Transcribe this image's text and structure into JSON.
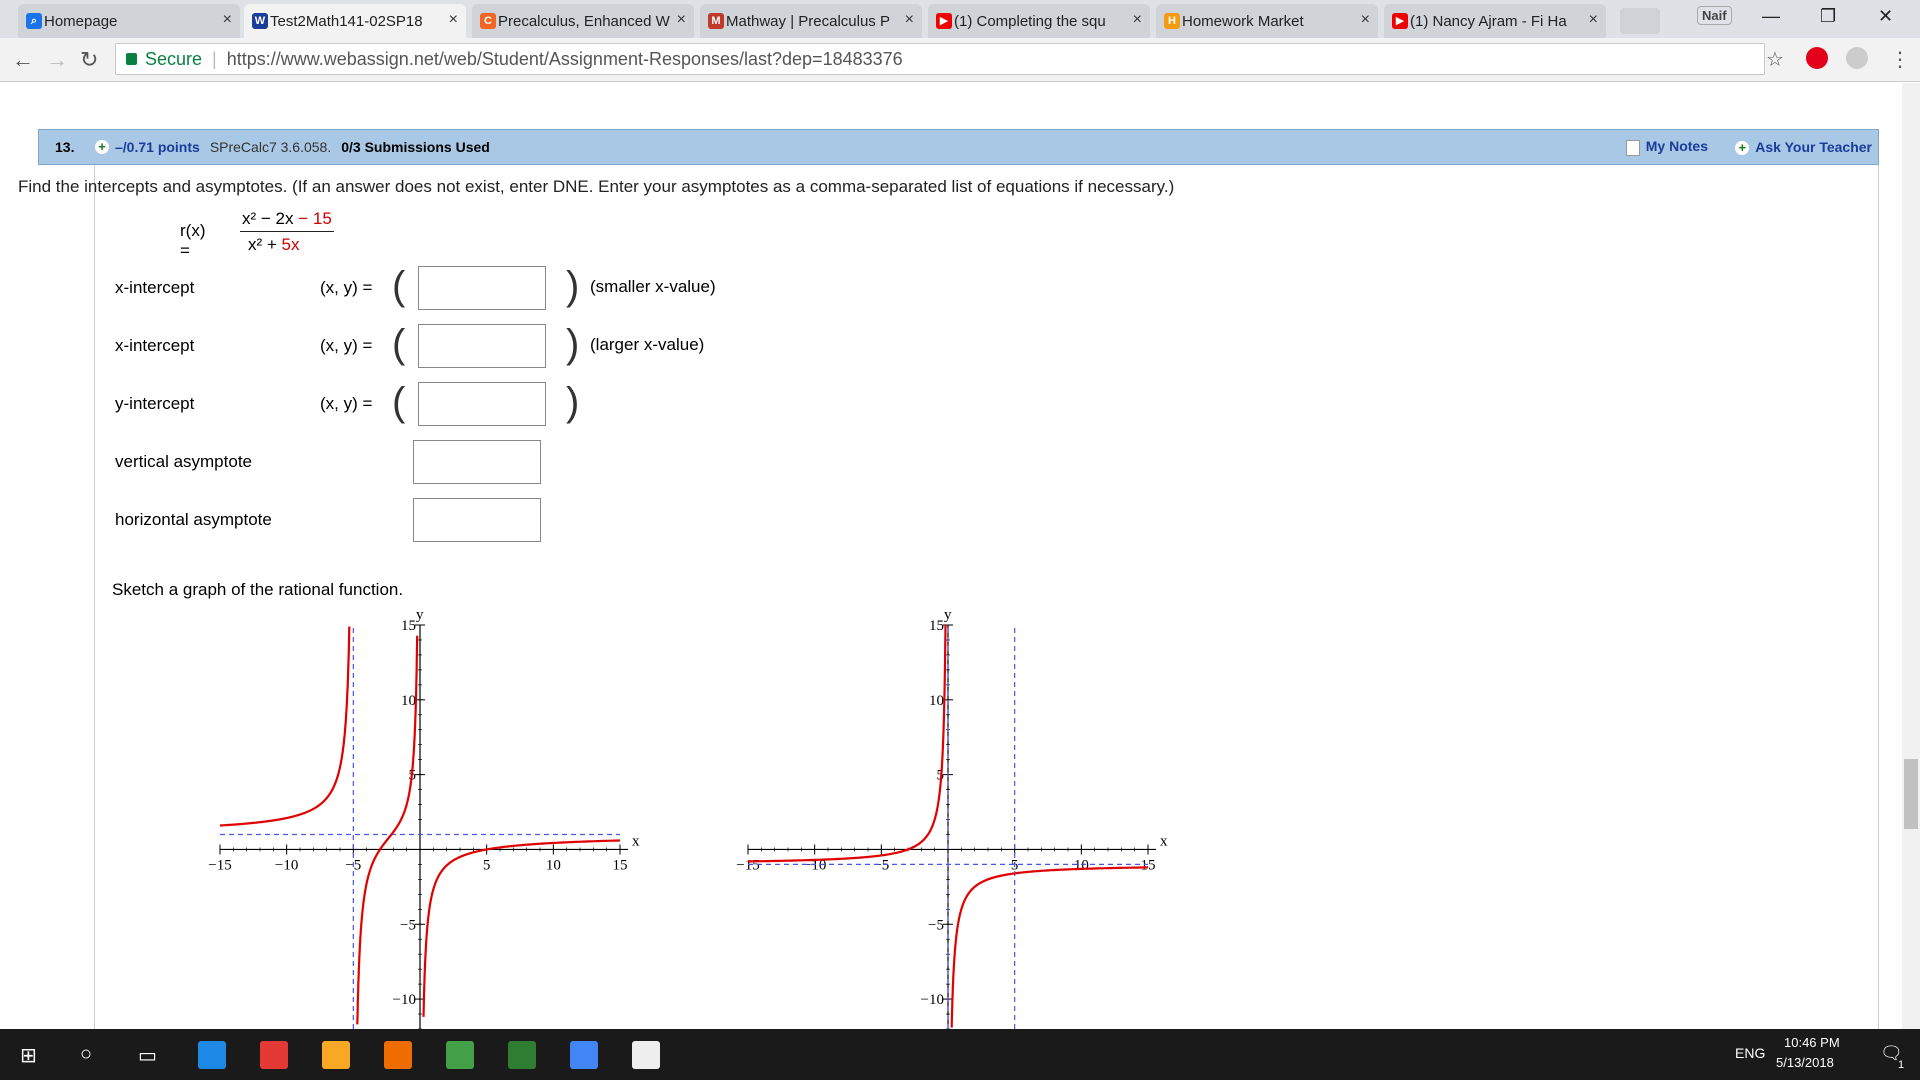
{
  "browser": {
    "tabs": [
      {
        "label": "Homepage",
        "icon": "search-icon",
        "color": "#1a73e8"
      },
      {
        "label": "Test2Math141-02SP18",
        "icon": "webassign-icon",
        "color": "#1a3d99"
      },
      {
        "label": "Precalculus, Enhanced W",
        "icon": "cengage-icon",
        "color": "#f26522"
      },
      {
        "label": "Mathway | Precalculus P",
        "icon": "mathway-icon",
        "color": "#c0392b"
      },
      {
        "label": "(1) Completing the squ",
        "icon": "youtube-icon",
        "color": "#e00"
      },
      {
        "label": "Homework Market",
        "icon": "homework-market-icon",
        "color": "#f39c12"
      },
      {
        "label": "(1) Nancy Ajram - Fi Ha",
        "icon": "youtube-icon",
        "color": "#e00"
      }
    ],
    "user_badge": "Naif",
    "address": {
      "secure_label": "Secure",
      "url": "https://www.webassign.net/web/Student/Assignment-Responses/last?dep=18483376"
    }
  },
  "question": {
    "number": "13.",
    "points": "–/0.71 points",
    "code": "SPreCalc7 3.6.058.",
    "submissions": "0/3 Submissions Used",
    "my_notes": "My Notes",
    "ask_teacher": "Ask Your Teacher",
    "instructions": "Find the intercepts and asymptotes. (If an answer does not exist, enter DNE. Enter your asymptotes as a comma-separated list of equations if necessary.)",
    "function": {
      "name": "r(x) =",
      "num_black": "x² − 2x",
      "num_red": "− 15",
      "den_black": "x² +",
      "den_red": "5x"
    },
    "rows": [
      {
        "label": "x-intercept",
        "xy": "(x, y) =",
        "note": "(smaller x-value)",
        "value": ""
      },
      {
        "label": "x-intercept",
        "xy": "(x, y) =",
        "note": "(larger x-value)",
        "value": ""
      },
      {
        "label": "y-intercept",
        "xy": "(x, y) =",
        "note": "",
        "value": ""
      },
      {
        "label": "vertical asymptote",
        "xy": "",
        "note": "",
        "value": ""
      },
      {
        "label": "horizontal asymptote",
        "xy": "",
        "note": "",
        "value": ""
      }
    ],
    "sketch_prompt": "Sketch a graph of the rational function."
  },
  "chart_data": [
    {
      "type": "line",
      "xlabel": "x",
      "ylabel": "y",
      "xlim": [
        -15,
        15
      ],
      "ylim": [
        -12,
        15
      ],
      "xticks": [
        -15,
        -10,
        -5,
        5,
        10,
        15
      ],
      "yticks": [
        -10,
        -5,
        5,
        10,
        15
      ],
      "asymptotes": {
        "vertical": [
          -5
        ],
        "horizontal": [
          1
        ]
      },
      "function_desc": "curve with vertical asymptote x=-5 and horizontal asymptote y=1",
      "color": "#e00000"
    },
    {
      "type": "line",
      "xlabel": "x",
      "ylabel": "y",
      "xlim": [
        -15,
        15
      ],
      "ylim": [
        -12,
        15
      ],
      "xticks": [
        -15,
        -10,
        -5,
        5,
        10,
        15
      ],
      "yticks": [
        -10,
        -5,
        5,
        10,
        15
      ],
      "asymptotes": {
        "vertical": [
          0,
          5
        ],
        "horizontal": [
          -1
        ]
      },
      "function_desc": "curve with vertical asymptotes x=0, x=5 and horizontal asymptote y=-1",
      "color": "#e00000"
    }
  ],
  "taskbar": {
    "time": "10:46 PM",
    "date": "5/13/2018",
    "lang": "ENG",
    "notif_count": "1"
  }
}
